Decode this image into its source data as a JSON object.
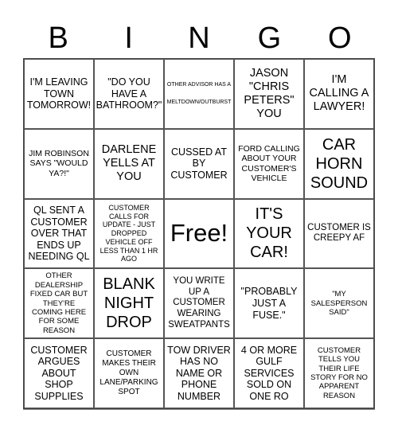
{
  "header": {
    "letters": [
      "B",
      "I",
      "N",
      "G",
      "O"
    ]
  },
  "board": {
    "rows": [
      [
        {
          "text": "I'M LEAVING TOWN TOMORROW!"
        },
        {
          "text": "\"DO YOU HAVE A BATHROOM?\""
        },
        {
          "text": "OTHER ADVISOR HAS A MELTDOWN/OUTBURST"
        },
        {
          "text": "JASON \"CHRIS PETERS\" YOU"
        },
        {
          "text": "I'M CALLING A LAWYER!"
        }
      ],
      [
        {
          "text": "JIM ROBINSON SAYS \"WOULD YA?!\""
        },
        {
          "text": "DARLENE YELLS AT YOU"
        },
        {
          "text": "CUSSED AT BY CUSTOMER"
        },
        {
          "text": "FORD CALLING ABOUT YOUR CUSTOMER'S VEHICLE"
        },
        {
          "text": "CAR HORN SOUND"
        }
      ],
      [
        {
          "text": "QL SENT A CUSTOMER OVER THAT ENDS UP NEEDING QL"
        },
        {
          "text": "CUSTOMER CALLS FOR UPDATE - JUST DROPPED VEHICLE OFF LESS THAN 1 HR AGO"
        },
        {
          "text": "Free!"
        },
        {
          "text": "IT'S YOUR CAR!"
        },
        {
          "text": "CUSTOMER IS CREEPY AF"
        }
      ],
      [
        {
          "text": "OTHER DEALERSHIP FIXED CAR BUT THEY'RE COMING HERE FOR SOME REASON"
        },
        {
          "text": "BLANK NIGHT DROP"
        },
        {
          "text": "YOU WRITE UP A CUSTOMER WEARING SWEATPANTS"
        },
        {
          "text": "\"PROBABLY JUST A FUSE.\""
        },
        {
          "text": "\"MY SALESPERSON SAID\""
        }
      ],
      [
        {
          "text": "CUSTOMER ARGUES ABOUT SHOP SUPPLIES"
        },
        {
          "text": "CUSTOMER MAKES THEIR OWN LANE/PARKING SPOT"
        },
        {
          "text": "TOW DRIVER HAS NO NAME OR PHONE NUMBER"
        },
        {
          "text": "4 OR MORE GULF SERVICES SOLD ON ONE RO"
        },
        {
          "text": "CUSTOMER TELLS YOU THEIR LIFE STORY FOR NO APPARENT REASON"
        }
      ]
    ]
  }
}
